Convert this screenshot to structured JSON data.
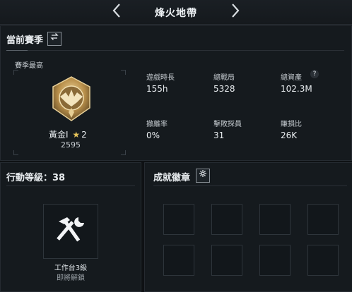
{
  "header": {
    "title": "烽火地帶",
    "prev_icon": "chevron-left-icon",
    "next_icon": "chevron-right-icon"
  },
  "season": {
    "title": "當前賽季",
    "swap_icon": "swap-icon",
    "best_label": "賽季最高",
    "rank_name": "黃金I",
    "rank_star_count": "2",
    "rank_score": "2595",
    "stats": [
      {
        "label": "遊戲時長",
        "value": "155h"
      },
      {
        "label": "總戰局",
        "value": "5328"
      },
      {
        "label": "總資產",
        "value": "102.3M",
        "help": "?"
      },
      {
        "label": "撤離率",
        "value": "0%"
      },
      {
        "label": "擊敗探員",
        "value": "31"
      },
      {
        "label": "賺損比",
        "value": "26K"
      }
    ]
  },
  "action_level": {
    "title": "行動等級：38",
    "workbench_name": "工作台3級",
    "workbench_status": "即將解鎖"
  },
  "achievements": {
    "title": "成就徽章",
    "gear_icon": "gear-icon"
  },
  "colors": {
    "accent_gold": "#c9a45a",
    "panel_bg": "#151a1e",
    "bg": "#0e1114"
  }
}
